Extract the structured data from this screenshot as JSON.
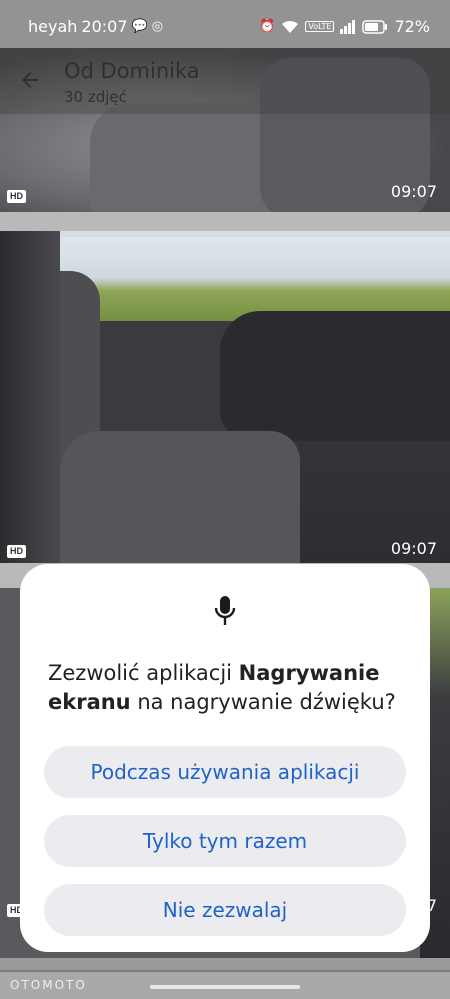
{
  "status_bar": {
    "carrier": "heyah",
    "time": "20:07",
    "battery": "72%",
    "volte": "VoLTE"
  },
  "gallery": {
    "title": "Od Dominika",
    "subtitle": "30 zdjęć",
    "photos": [
      {
        "badge": "HD",
        "time": "09:07"
      },
      {
        "badge": "HD",
        "time": "09:07"
      },
      {
        "badge": "HD",
        "time": "07"
      }
    ]
  },
  "dialog": {
    "prompt_before": "Zezwolić aplikacji ",
    "app_name": "Nagrywanie ekranu",
    "prompt_after": " na nagrywanie dźwięku?",
    "buttons": {
      "while_using": "Podczas używania aplikacji",
      "only_this_time": "Tylko tym razem",
      "deny": "Nie zezwalaj"
    },
    "accent_color": "#1f63c9"
  },
  "footer": {
    "brand": "OTOMOTO"
  }
}
